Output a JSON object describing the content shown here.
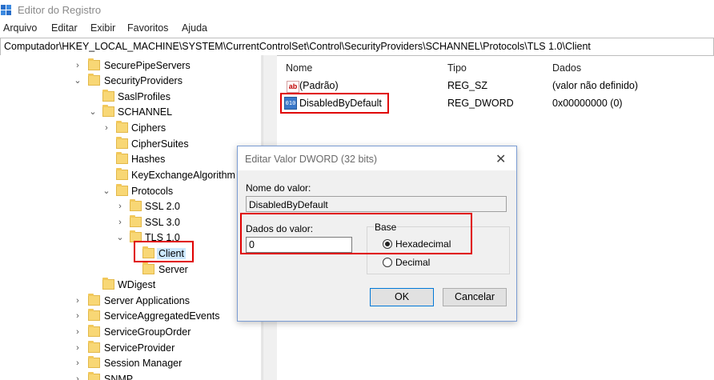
{
  "window": {
    "title": "Editor do Registro"
  },
  "menu": [
    "Arquivo",
    "Editar",
    "Exibir",
    "Favoritos",
    "Ajuda"
  ],
  "address": "Computador\\HKEY_LOCAL_MACHINE\\SYSTEM\\CurrentControlSet\\Control\\SecurityProviders\\SCHANNEL\\Protocols\\TLS 1.0\\Client",
  "tree": [
    {
      "label": "SecurePipeServers",
      "chevron": "›"
    },
    {
      "label": "SecurityProviders",
      "chevron": "⌄"
    },
    {
      "label": "SaslProfiles",
      "chevron": ""
    },
    {
      "label": "SCHANNEL",
      "chevron": "⌄"
    },
    {
      "label": "Ciphers",
      "chevron": "›"
    },
    {
      "label": "CipherSuites",
      "chevron": ""
    },
    {
      "label": "Hashes",
      "chevron": ""
    },
    {
      "label": "KeyExchangeAlgorithm",
      "chevron": ""
    },
    {
      "label": "Protocols",
      "chevron": "⌄"
    },
    {
      "label": "SSL 2.0",
      "chevron": "›"
    },
    {
      "label": "SSL 3.0",
      "chevron": "›"
    },
    {
      "label": "TLS 1.0",
      "chevron": "⌄"
    },
    {
      "label": "Client",
      "chevron": ""
    },
    {
      "label": "Server",
      "chevron": ""
    },
    {
      "label": "WDigest",
      "chevron": ""
    },
    {
      "label": "Server Applications",
      "chevron": "›"
    },
    {
      "label": "ServiceAggregatedEvents",
      "chevron": "›"
    },
    {
      "label": "ServiceGroupOrder",
      "chevron": "›"
    },
    {
      "label": "ServiceProvider",
      "chevron": "›"
    },
    {
      "label": "Session Manager",
      "chevron": "›"
    },
    {
      "label": "SNMP",
      "chevron": "›"
    }
  ],
  "values_pane": {
    "columns": {
      "name": "Nome",
      "type": "Tipo",
      "data": "Dados"
    },
    "rows": [
      {
        "icon": "ab",
        "name": "(Padrão)",
        "type": "REG_SZ",
        "data": "(valor não definido)"
      },
      {
        "icon": "010",
        "name": "DisabledByDefault",
        "type": "REG_DWORD",
        "data": "0x00000000 (0)"
      }
    ]
  },
  "dialog": {
    "title": "Editar Valor DWORD (32 bits)",
    "close": "✕",
    "name_label": "Nome do valor:",
    "name_value": "DisabledByDefault",
    "data_label": "Dados do valor:",
    "data_value": "0",
    "base_label": "Base",
    "hex_label": "Hexadecimal",
    "dec_label": "Decimal",
    "ok_label": "OK",
    "cancel_label": "Cancelar"
  }
}
